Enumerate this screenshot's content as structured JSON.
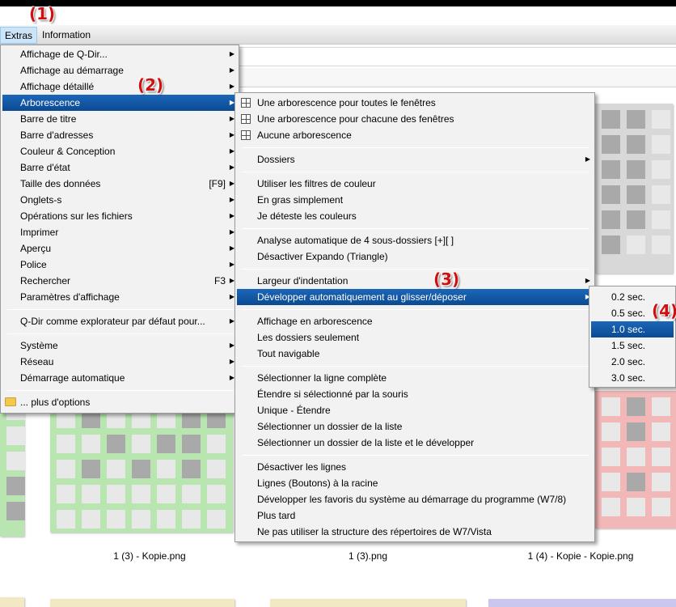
{
  "menubar": {
    "items": [
      "Extras",
      "Information"
    ]
  },
  "badges": [
    "(1)",
    "(2)",
    "(3)",
    "(4)"
  ],
  "extras_menu": {
    "groups": [
      [
        {
          "label": "Affichage de Q-Dir...",
          "submenu": true
        },
        {
          "label": "Affichage au démarrage",
          "submenu": true
        },
        {
          "label": "Affichage détaillé",
          "submenu": true
        },
        {
          "label": "Arborescence",
          "submenu": true,
          "selected": true
        },
        {
          "label": "Barre de titre",
          "submenu": true
        },
        {
          "label": "Barre d'adresses",
          "submenu": true
        },
        {
          "label": "Couleur & Conception",
          "submenu": true
        },
        {
          "label": "Barre d'état",
          "submenu": true
        },
        {
          "label": "Taille des données",
          "shortcut": "[F9]",
          "submenu": true
        },
        {
          "label": "Onglets-s",
          "submenu": true
        },
        {
          "label": "Opérations sur les fichiers",
          "submenu": true
        },
        {
          "label": "Imprimer",
          "submenu": true
        },
        {
          "label": "Aperçu",
          "submenu": true
        },
        {
          "label": "Police",
          "submenu": true
        },
        {
          "label": "Rechercher",
          "shortcut": "F3",
          "submenu": true
        },
        {
          "label": "Paramètres d'affichage",
          "submenu": true
        }
      ],
      [
        {
          "label": "Q-Dir comme explorateur par défaut pour...",
          "submenu": true
        }
      ],
      [
        {
          "label": "Système",
          "submenu": true
        },
        {
          "label": "Réseau",
          "submenu": true
        },
        {
          "label": "Démarrage automatique",
          "submenu": true
        }
      ],
      [
        {
          "label": "... plus d'options",
          "icon": "folder-icon"
        }
      ]
    ]
  },
  "tree_menu": {
    "groups": [
      [
        {
          "label": "Une arborescence pour toutes le fenêtres",
          "icon": "grid-icon"
        },
        {
          "label": "Une arborescence pour chacune des fenêtres",
          "icon": "grid-icon"
        },
        {
          "label": "Aucune arborescence",
          "icon": "grid-icon"
        }
      ],
      [
        {
          "label": "Dossiers",
          "submenu": true
        }
      ],
      [
        {
          "label": "Utiliser les filtres de couleur"
        },
        {
          "label": "En gras simplement"
        },
        {
          "label": "Je déteste les couleurs"
        }
      ],
      [
        {
          "label": "Analyse automatique de 4 sous-dossiers [+][ ]"
        },
        {
          "label": "Désactiver Expando (Triangle)"
        }
      ],
      [
        {
          "label": "Largeur d'indentation",
          "submenu": true
        },
        {
          "label": "Développer automatiquement au glisser/déposer",
          "submenu": true,
          "selected": true
        }
      ],
      [
        {
          "label": "Affichage en arborescence"
        },
        {
          "label": "Les dossiers seulement"
        },
        {
          "label": "Tout navigable"
        }
      ],
      [
        {
          "label": "Sélectionner la ligne complète"
        },
        {
          "label": "Étendre si sélectionné par la souris"
        },
        {
          "label": "Unique - Étendre"
        },
        {
          "label": "Sélectionner un dossier de la liste"
        },
        {
          "label": "Sélectionner un dossier de la liste et le développer"
        }
      ],
      [
        {
          "label": "Désactiver les lignes"
        },
        {
          "label": "Lignes (Boutons) à la racine"
        },
        {
          "label": "Développer les favoris du système au démarrage du programme (W7/8)"
        },
        {
          "label": "Plus tard"
        },
        {
          "label": "Ne pas utiliser la structure des répertoires de W7/Vista"
        }
      ]
    ]
  },
  "delay_menu": {
    "items": [
      {
        "label": "0.2 sec."
      },
      {
        "label": "0.5 sec."
      },
      {
        "label": "1.0 sec.",
        "selected": true
      },
      {
        "label": "1.5 sec."
      },
      {
        "label": "2.0 sec."
      },
      {
        "label": "3.0 sec."
      }
    ]
  },
  "files": [
    "1 (3) - Kopie.png",
    "1 (3).png",
    "1 (4) - Kopie - Kopie.png"
  ],
  "colors": {
    "accent": "#0b4a92",
    "badge": "#d01010",
    "thumb_green": "#b9e6b0",
    "thumb_red": "#f2b7b7",
    "thumb_yellow": "#f2e9c2",
    "thumb_purple": "#c9c6ef",
    "cell_dark": "#a9a9a9",
    "cell_light": "#e8e8e8"
  }
}
